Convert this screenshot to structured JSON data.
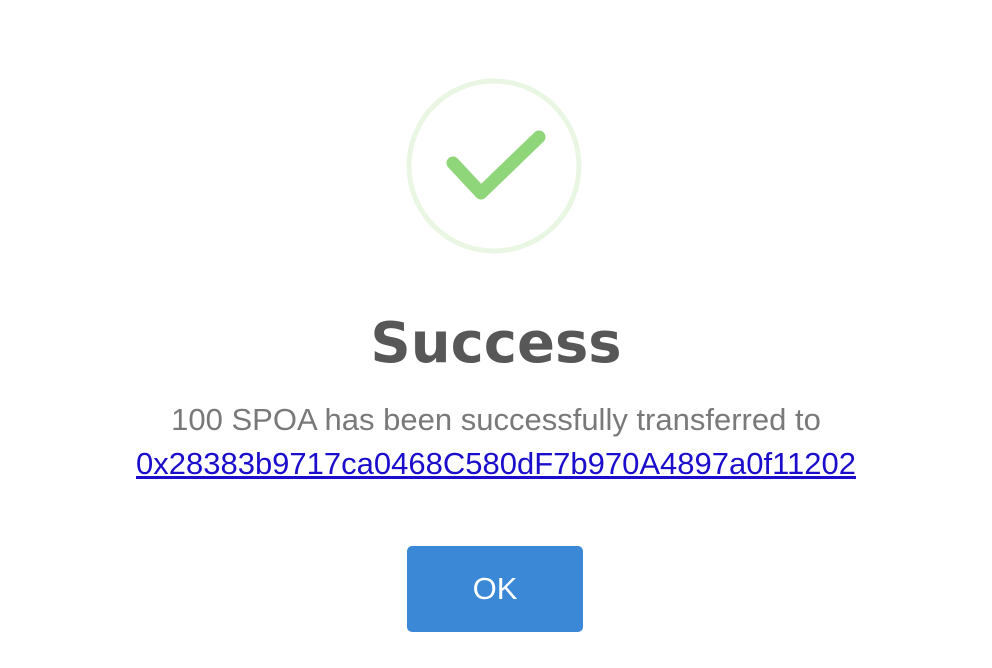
{
  "dialog": {
    "icon": "success-checkmark-icon",
    "title": "Success",
    "message_prefix": "100 SPOA has been successfully transferred to",
    "address": "0x28383b9717ca0468C580dF7b970A4897a0f11202",
    "ok_label": "OK"
  },
  "colors": {
    "checkmark": "#8fd57a",
    "circle_ring": "#eaf6e4",
    "title": "#575757",
    "message": "#797979",
    "link": "#1a0dcc",
    "button_bg": "#3a88d6",
    "button_text": "#ffffff"
  }
}
